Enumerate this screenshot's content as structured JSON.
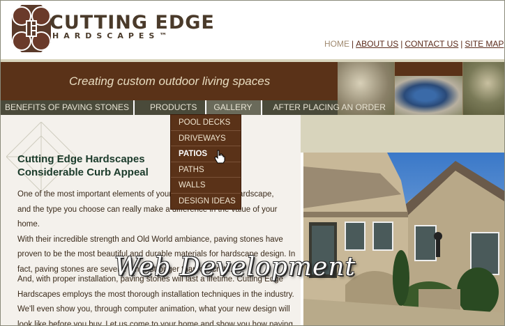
{
  "brand": {
    "line1": "CUTTING EDGE",
    "line2": "HARDSCAPES™"
  },
  "topnav": {
    "items": [
      {
        "label": "HOME",
        "current": true
      },
      {
        "label": "ABOUT US",
        "current": false
      },
      {
        "label": "CONTACT US",
        "current": false
      },
      {
        "label": "SITE MAP",
        "current": false
      }
    ],
    "separator": "|"
  },
  "banner": {
    "tagline": "Creating custom outdoor living spaces"
  },
  "mainnav": {
    "items": [
      {
        "label": "BENEFITS OF PAVING STONES"
      },
      {
        "label": "PRODUCTS"
      },
      {
        "label": "GALLERY",
        "open": true
      },
      {
        "label": "AFTER PLACING AN ORDER"
      }
    ]
  },
  "gallery_menu": {
    "items": [
      {
        "label": "POOL DECKS"
      },
      {
        "label": "DRIVEWAYS"
      },
      {
        "label": "PATIOS",
        "hovered": true
      },
      {
        "label": "PATHS"
      },
      {
        "label": "WALLS"
      },
      {
        "label": "DESIGN IDEAS"
      }
    ]
  },
  "content": {
    "heading_line1": "Cutting Edge Hardscapes",
    "heading_line2": "Considerable Curb Appeal",
    "paragraph1_lines": [
      "One of the most important elements of your landscape is the hardscape,",
      "and the type you choose can really make a difference in the value of your home.",
      "With their incredible strength and Old World ambiance, paving stones have",
      "proven to be the most beautiful and durable materials for hardscape design. In",
      "fact, paving stones are several times stronger than concrete."
    ],
    "paragraph2_lines": [
      "And, with proper installation, paving stones will last a lifetime. Cutting Edge",
      "Hardscapes employs the most thorough installation techniques in the industry.",
      "We'll even show you, through computer animation, what your new design will",
      "look like before you buy. Let us come to your home and show you how paving"
    ]
  },
  "watermark": {
    "text": "Web Development"
  },
  "colors": {
    "banner_brown": "#5a3218",
    "nav_olive": "#4a4a3a",
    "heading_green": "#1a3a2a",
    "content_bg": "#f4f1ec"
  }
}
